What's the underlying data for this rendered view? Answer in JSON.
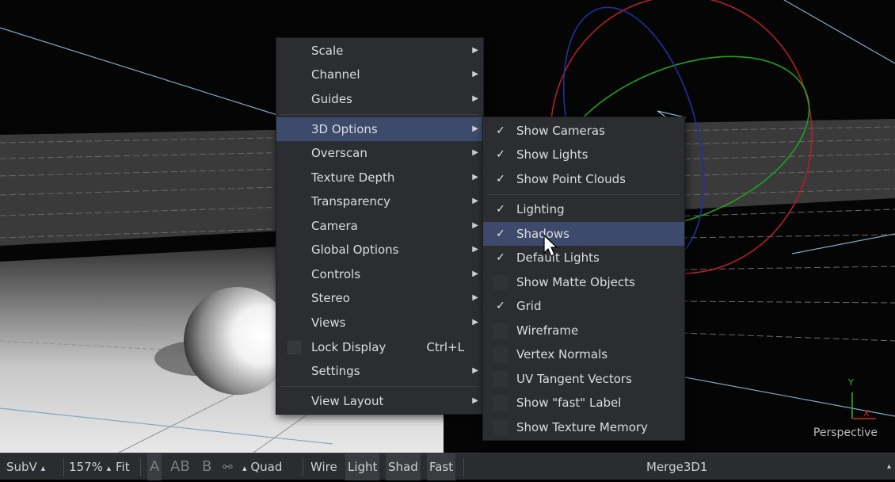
{
  "viewport": {
    "view_label": "Perspective"
  },
  "main_menu": {
    "items": [
      {
        "label": "Scale"
      },
      {
        "label": "Channel"
      },
      {
        "label": "Guides"
      },
      {
        "label": "3D Options"
      },
      {
        "label": "Overscan"
      },
      {
        "label": "Texture Depth"
      },
      {
        "label": "Transparency"
      },
      {
        "label": "Camera"
      },
      {
        "label": "Global Options"
      },
      {
        "label": "Controls"
      },
      {
        "label": "Stereo"
      },
      {
        "label": "Views"
      },
      {
        "label": "Lock Display",
        "shortcut": "Ctrl+L"
      },
      {
        "label": "Settings"
      },
      {
        "label": "View Layout"
      }
    ],
    "highlighted": "3D Options"
  },
  "submenu_3d_options": {
    "checkmark_glyph": "✓",
    "items": [
      {
        "label": "Show Cameras",
        "checked": true
      },
      {
        "label": "Show Lights",
        "checked": true
      },
      {
        "label": "Show Point Clouds",
        "checked": true
      },
      {
        "label": "Lighting",
        "checked": true
      },
      {
        "label": "Shadows",
        "checked": true
      },
      {
        "label": "Default Lights",
        "checked": true
      },
      {
        "label": "Show Matte Objects",
        "checked": false
      },
      {
        "label": "Grid",
        "checked": true
      },
      {
        "label": "Wireframe",
        "checked": false
      },
      {
        "label": "Vertex Normals",
        "checked": false
      },
      {
        "label": "UV Tangent Vectors",
        "checked": false
      },
      {
        "label": "Show \"fast\" Label",
        "checked": false
      },
      {
        "label": "Show Texture Memory",
        "checked": false
      }
    ],
    "highlighted": "Shadows"
  },
  "toolbar": {
    "subv": "SubV",
    "zoom": "157%",
    "fit": "Fit",
    "channel_a": "A",
    "channel_ab": "AB",
    "channel_b": "B",
    "quad": "Quad",
    "wire": "Wire",
    "light": "Light",
    "shad": "Shad",
    "fast": "Fast",
    "node_name": "Merge3D1",
    "dropdown_glyph": "▴"
  },
  "colors": {
    "menu_bg": "#2b2d31",
    "highlight": "#3d4a6c",
    "toolbar_bg": "#2a2c30",
    "axis_x": "#d42020",
    "axis_y": "#20c020"
  },
  "icons": {
    "cursor": "mouse-pointer-icon",
    "submenu_arrow": "chevron-right-icon",
    "checkbox": "checkmark-icon",
    "stereo_glasses": "stereo-glasses-icon"
  }
}
